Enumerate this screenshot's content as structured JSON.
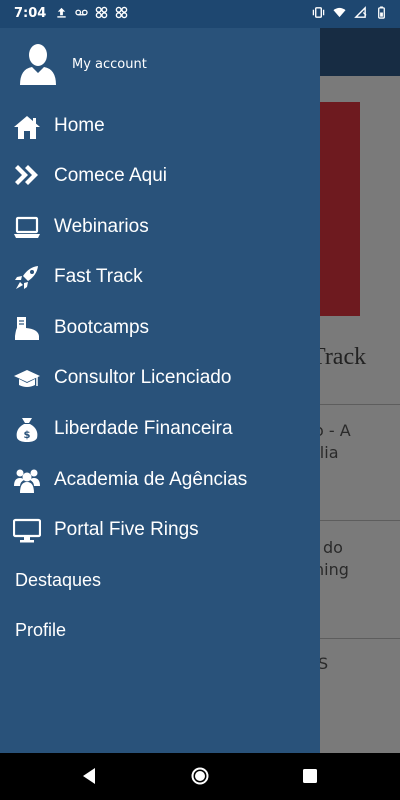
{
  "status_bar": {
    "time": "7:04",
    "left_icons": [
      "upload-icon",
      "voicemail-icon",
      "app-notification-icon",
      "app-notification-icon"
    ],
    "right_icons": [
      "vibrate-icon",
      "wifi-icon",
      "no-sim-icon",
      "battery-icon"
    ]
  },
  "drawer": {
    "account_label": "My account",
    "menu": [
      {
        "label": "Home",
        "icon": "home-icon"
      },
      {
        "label": "Comece Aqui",
        "icon": "double-chevron-right-icon"
      },
      {
        "label": "Webinarios",
        "icon": "laptop-icon"
      },
      {
        "label": "Fast Track",
        "icon": "rocket-icon"
      },
      {
        "label": "Bootcamps",
        "icon": "boot-icon"
      },
      {
        "label": "Consultor Licenciado",
        "icon": "graduation-cap-icon"
      },
      {
        "label": "Liberdade Financeira",
        "icon": "money-bag-icon"
      },
      {
        "label": "Academia de Agências",
        "icon": "users-icon"
      },
      {
        "label": "Portal Five Rings",
        "icon": "desktop-icon"
      }
    ],
    "extra_items": [
      "Destaques",
      "Profile"
    ]
  },
  "background": {
    "heading_fragment": "Track",
    "text_fragments": [
      "o - A",
      "alia",
      "do",
      "ning",
      "S"
    ]
  },
  "nav_bar": {
    "buttons": [
      "back-button",
      "home-button",
      "recents-button"
    ]
  },
  "colors": {
    "drawer_bg": "#29527a",
    "status_bar_bg": "#1e4770",
    "scrim_bg": "#7a7a7a",
    "banner_red": "#6e1a1f"
  }
}
